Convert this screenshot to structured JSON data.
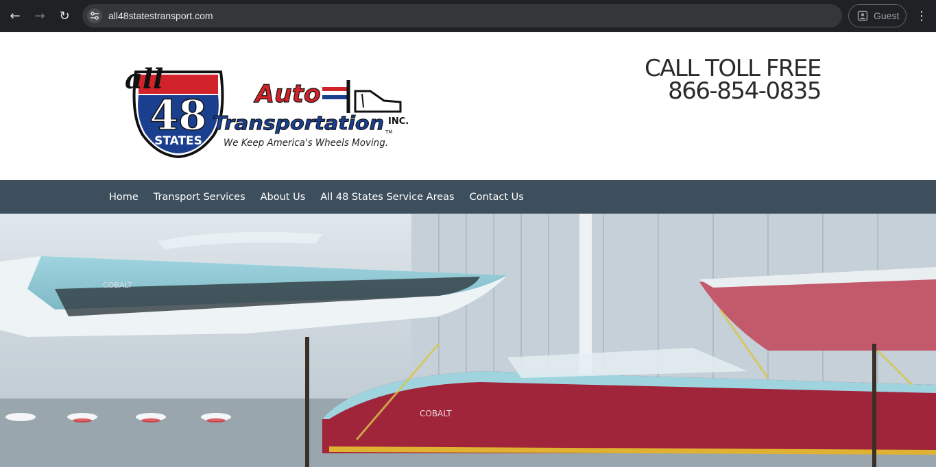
{
  "browser": {
    "url": "all48statestransport.com",
    "profile_label": "Guest",
    "back_glyph": "←",
    "forward_glyph": "→",
    "reload_glyph": "↻",
    "menu_glyph": "⋮"
  },
  "header": {
    "logo": {
      "all": "all",
      "number": "48",
      "states": "STATES",
      "auto": "Auto",
      "transportation": "Transportation",
      "inc": "INC.",
      "tm": "TM",
      "tagline": "We Keep America's Wheels Moving."
    },
    "call_label": "CALL TOLL FREE",
    "phone": "866-854-0835"
  },
  "nav": {
    "items": [
      {
        "label": "Home"
      },
      {
        "label": "Transport Services"
      },
      {
        "label": "About Us"
      },
      {
        "label": "All 48 States Service Areas"
      },
      {
        "label": "Contact Us"
      }
    ]
  },
  "hero": {
    "boat_brand_label": "COBALT"
  },
  "colors": {
    "nav_bg": "#3d4f5d",
    "shield_blue": "#1b3f8f",
    "shield_red": "#d2232a",
    "boat_red": "#a0243a"
  }
}
